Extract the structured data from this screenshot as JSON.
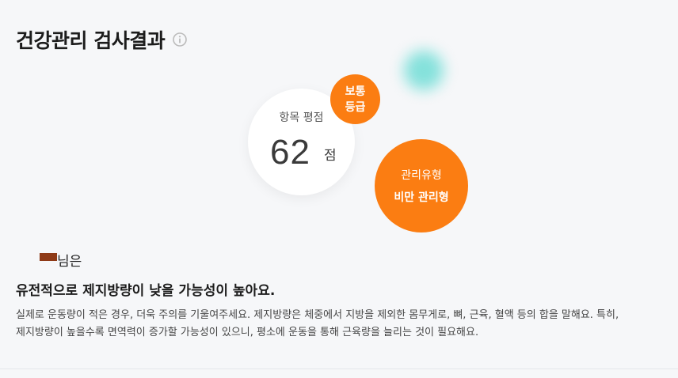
{
  "header": {
    "title": "건강관리 검사결과"
  },
  "score": {
    "label": "항목 평점",
    "value": "62",
    "unit": "점"
  },
  "grade": {
    "line1": "보통",
    "line2": "등급"
  },
  "management_type": {
    "label": "관리유형",
    "value": "비만 관리형"
  },
  "user": {
    "suffix": "님은"
  },
  "result": {
    "headline": "유전적으로 제지방량이 낮을 가능성이 높아요.",
    "line1": "실제로 운동량이 적은 경우, 더욱 주의를 기울여주세요. 제지방량은 체중에서 지방을 제외한 몸무게로, 뼈, 근육, 혈액 등의 합을 말해요. 특히,",
    "line2": "제지방량이 높을수록 면역력이 증가할 가능성이 있으니, 평소에 운동을 통해 근육량을 늘리는 것이 필요해요."
  },
  "colors": {
    "accent": "#fb7d12",
    "glow": "#7fe0da",
    "background": "#f6f7f9"
  },
  "icons": {
    "info": "info-icon"
  }
}
